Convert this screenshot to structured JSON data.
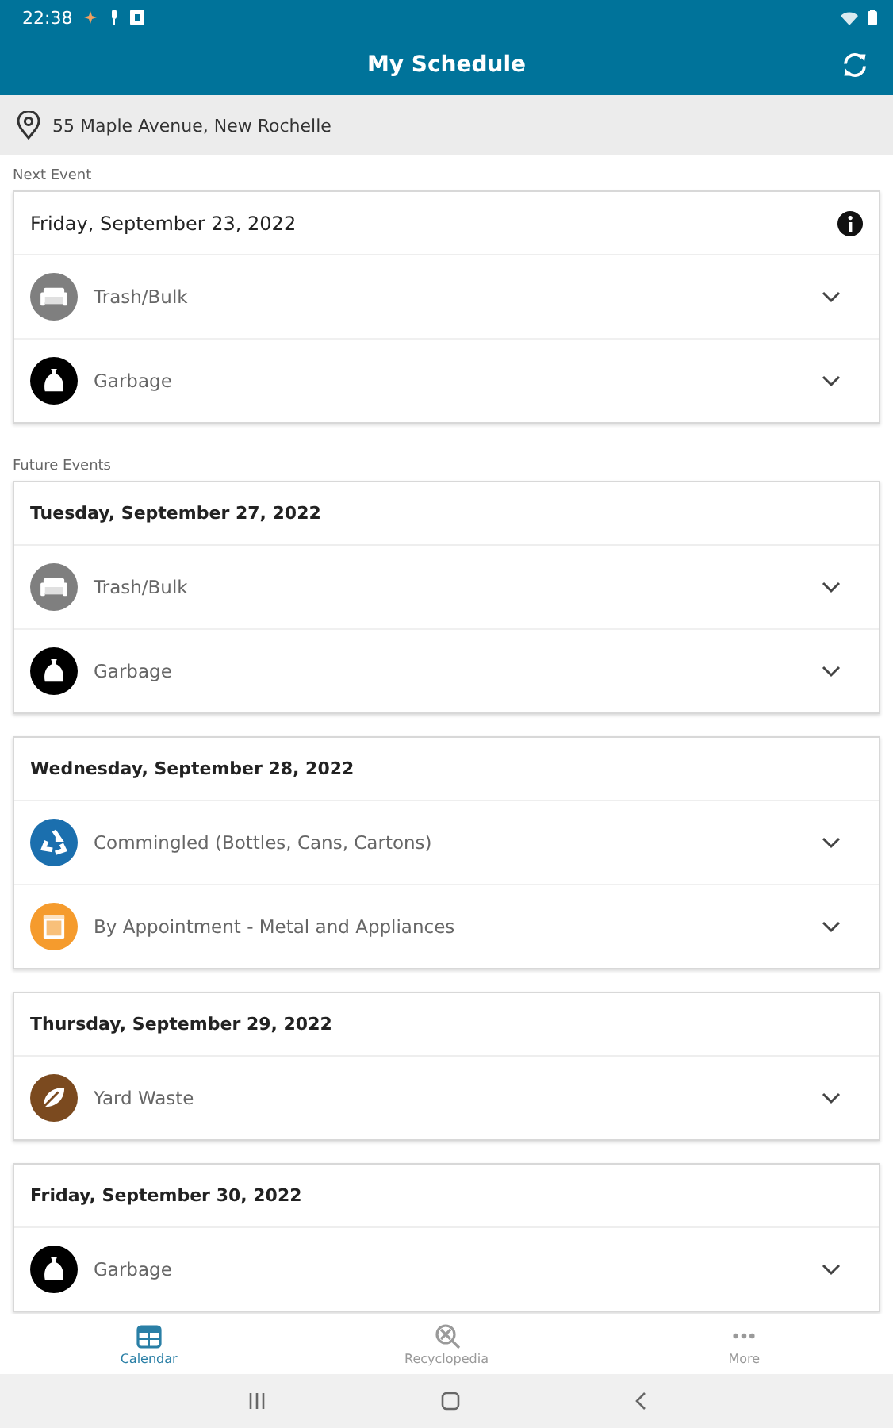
{
  "status_bar": {
    "time": "22:38"
  },
  "header": {
    "title": "My Schedule"
  },
  "address": "55 Maple Avenue, New Rochelle",
  "sections": [
    {
      "label": "Next Event",
      "kind": "next",
      "days": [
        {
          "date": "Friday, September 23, 2022",
          "info": true,
          "items": [
            {
              "label": "Trash/Bulk",
              "kind": "bulk",
              "color": "#7f7f7f"
            },
            {
              "label": "Garbage",
              "kind": "garbage",
              "color": "#000000"
            }
          ]
        }
      ]
    },
    {
      "label": "Future Events",
      "kind": "future",
      "days": [
        {
          "date": "Tuesday, September 27, 2022",
          "info": false,
          "items": [
            {
              "label": "Trash/Bulk",
              "kind": "bulk",
              "color": "#7f7f7f"
            },
            {
              "label": "Garbage",
              "kind": "garbage",
              "color": "#000000"
            }
          ]
        },
        {
          "date": "Wednesday, September 28, 2022",
          "info": false,
          "items": [
            {
              "label": "Commingled (Bottles, Cans, Cartons)",
              "kind": "recycle",
              "color": "#1b6fae"
            },
            {
              "label": "By Appointment - Metal and Appliances",
              "kind": "appointment",
              "color": "#f59b2d"
            }
          ]
        },
        {
          "date": "Thursday, September 29, 2022",
          "info": false,
          "items": [
            {
              "label": "Yard Waste",
              "kind": "yard",
              "color": "#7b4a1f"
            }
          ]
        },
        {
          "date": "Friday, September 30, 2022",
          "info": false,
          "items": [
            {
              "label": "Garbage",
              "kind": "garbage",
              "color": "#000000"
            }
          ]
        }
      ]
    }
  ],
  "tabs": [
    {
      "label": "Calendar",
      "kind": "calendar",
      "selected": true
    },
    {
      "label": "Recyclopedia",
      "kind": "search",
      "selected": false
    },
    {
      "label": "More",
      "kind": "more",
      "selected": false
    }
  ]
}
